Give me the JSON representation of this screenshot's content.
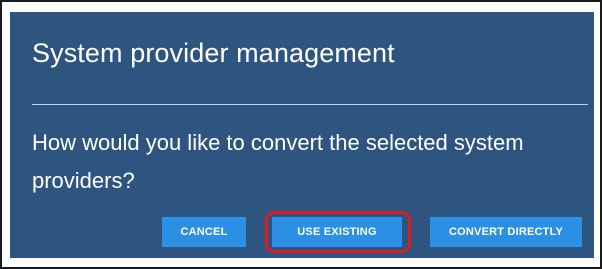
{
  "dialog": {
    "title": "System provider management",
    "message": "How would you like to convert the selected system providers?",
    "background_color": "#2e5480"
  },
  "buttons": {
    "cancel_label": "CANCEL",
    "use_existing_label": "USE EXISTING",
    "convert_directly_label": "CONVERT DIRECTLY",
    "button_color": "#2b8fe4"
  },
  "annotation": {
    "highlight_color": "#e01b24",
    "highlighted_button": "USE EXISTING"
  }
}
